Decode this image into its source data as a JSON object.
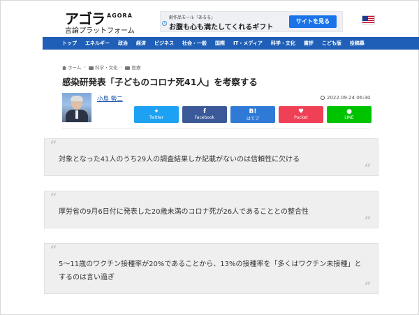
{
  "header": {
    "logo_main": "アゴラ",
    "logo_en": "AGORA",
    "logo_sub": "言論プラットフォーム"
  },
  "ad": {
    "small_text": "創作品モール「あるる」",
    "main_text": "お腹も心も満たしてくれるギフト",
    "button_label": "サイトを見る",
    "info_icon": "info-icon"
  },
  "language_flag": "us-flag-icon",
  "nav": {
    "items": [
      "トップ",
      "エネルギー",
      "政治",
      "経済",
      "ビジネス",
      "社会・一般",
      "国際",
      "IT・メディア",
      "科学・文化",
      "書評",
      "こども版",
      "投稿募"
    ]
  },
  "breadcrumb": {
    "home": "ホーム",
    "category": "科学・文化",
    "subcategory": "医療"
  },
  "article": {
    "title": "感染研発表「子どものコロナ死41人」を考察する",
    "author": "小島 勢二",
    "date": "2022.09.24 06:30"
  },
  "share": {
    "twitter": "Twitter",
    "facebook": "Facebook",
    "hatena": "はてブ",
    "hatena_glyph": "B!",
    "pocket": "Pocket",
    "line": "LINE"
  },
  "quotes": [
    "対象となった41人のうち29人の調査結果しか記載がないのは信頼性に欠ける",
    "厚労省の9月6日付に発表した20歳未満のコロナ死が26人であることとの整合性",
    "5～11歳のワクチン接種率が20%であることから、13%の接種率を「多くはワクチン未接種」とするのは言い過ぎ"
  ],
  "colors": {
    "nav": "#1f5fb8",
    "twitter": "#1da1f2",
    "facebook": "#3b5998",
    "hatena": "#2f7ad6",
    "pocket": "#ef4056",
    "line": "#00c300",
    "link": "#1a55b0"
  }
}
